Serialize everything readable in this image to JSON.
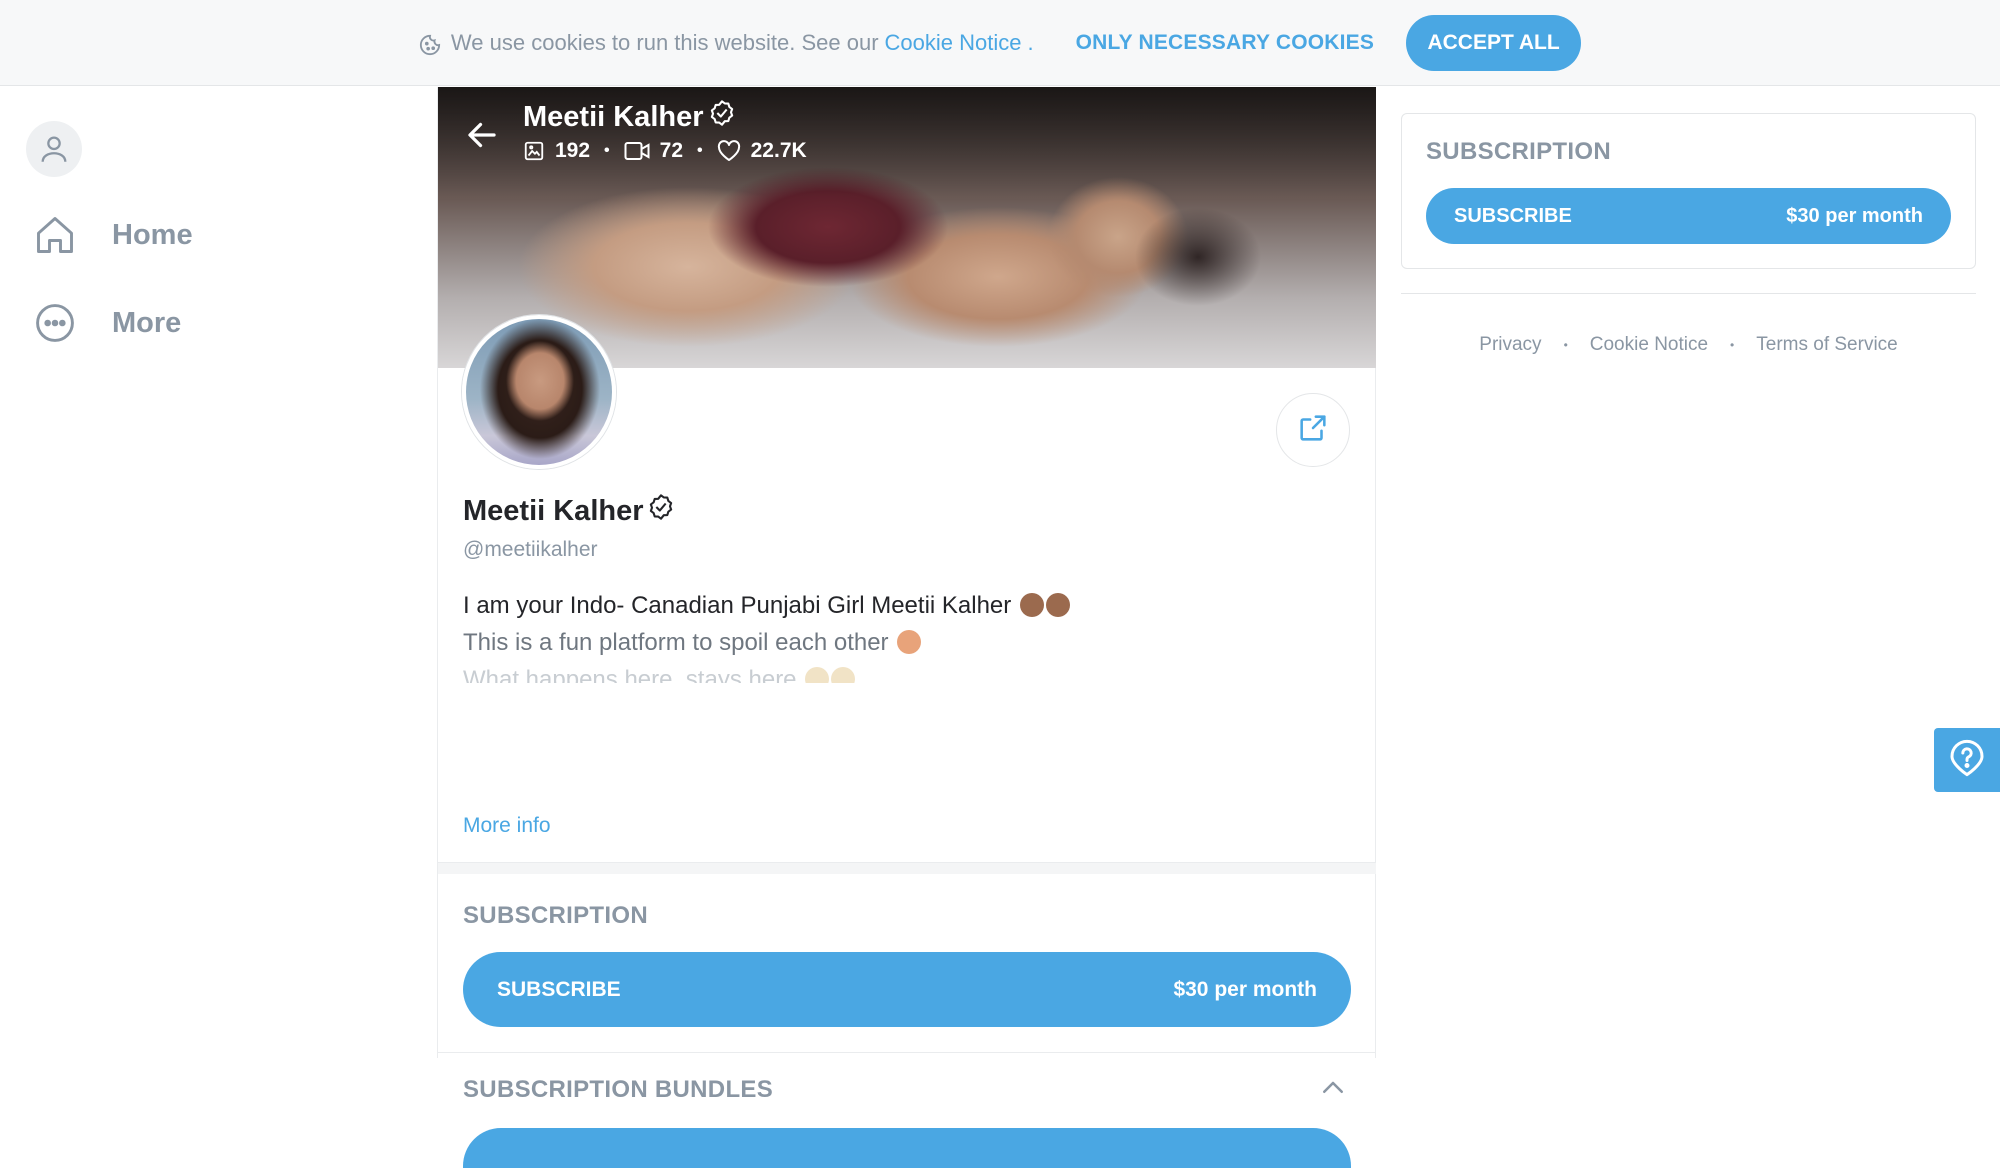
{
  "cookie_bar": {
    "text": "We use cookies to run this website. See our",
    "link": "Cookie Notice",
    "link_dot": ".",
    "necessary_label": "ONLY NECESSARY COOKIES",
    "accept_label": "ACCEPT ALL"
  },
  "sidebar": {
    "items": [
      {
        "label": "Home",
        "icon": "home-icon"
      },
      {
        "label": "More",
        "icon": "more-icon"
      }
    ]
  },
  "profile": {
    "name": "Meetii Kalher",
    "handle": "@meetiikalher",
    "stats": {
      "photos": "192",
      "videos": "72",
      "likes": "22.7K"
    },
    "bio": [
      "I am your Indo- Canadian Punjabi Girl Meetii Kalher",
      "This is a fun platform to spoil each other",
      "What happens here, stays here"
    ],
    "more_info": "More info"
  },
  "subscription": {
    "title": "SUBSCRIPTION",
    "button_label": "SUBSCRIBE",
    "price": "$30 per month"
  },
  "bundles": {
    "title": "SUBSCRIPTION BUNDLES"
  },
  "right_panel": {
    "title": "SUBSCRIPTION",
    "button_label": "SUBSCRIBE",
    "price": "$30 per month",
    "footer": [
      "Privacy",
      "Cookie Notice",
      "Terms of Service"
    ]
  },
  "colors": {
    "accent": "#4aa7e3",
    "muted": "#8a96a3",
    "text": "#242529"
  }
}
